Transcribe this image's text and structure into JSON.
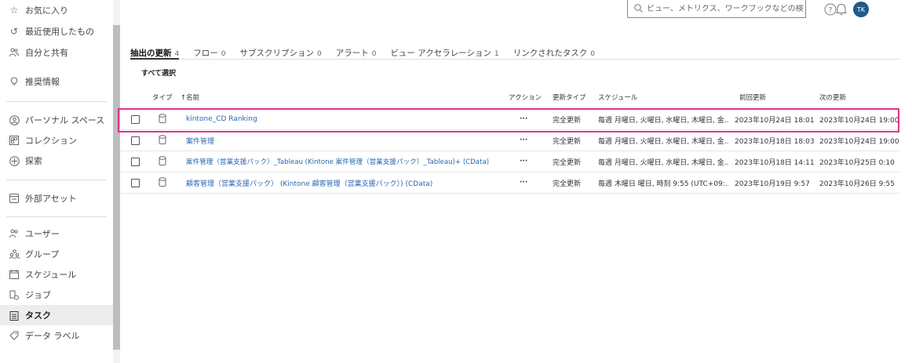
{
  "sidebar": {
    "items": [
      {
        "label": "お気に入り",
        "icon": "star-icon"
      },
      {
        "label": "最近使用したもの",
        "icon": "history-icon"
      },
      {
        "label": "自分と共有",
        "icon": "shared-users-icon"
      },
      {
        "label": "推奨情報",
        "icon": "lightbulb-icon"
      },
      {
        "label": "パーソナル スペース",
        "icon": "personal-space-icon"
      },
      {
        "label": "コレクション",
        "icon": "collection-icon"
      },
      {
        "label": "探索",
        "icon": "explore-icon"
      },
      {
        "label": "外部アセット",
        "icon": "external-assets-icon"
      },
      {
        "label": "ユーザー",
        "icon": "user-icon"
      },
      {
        "label": "グループ",
        "icon": "group-icon"
      },
      {
        "label": "スケジュール",
        "icon": "schedule-icon"
      },
      {
        "label": "ジョブ",
        "icon": "job-icon"
      },
      {
        "label": "タスク",
        "icon": "task-icon"
      },
      {
        "label": "データ ラベル",
        "icon": "data-label-icon"
      }
    ]
  },
  "header": {
    "search_placeholder": "ビュー、メトリクス、ワークブックなどの検索",
    "avatar_initials": "TK"
  },
  "tabs": [
    {
      "label": "抽出の更新",
      "count": "4"
    },
    {
      "label": "フロー",
      "count": "0"
    },
    {
      "label": "サブスクリプション",
      "count": "0"
    },
    {
      "label": "アラート",
      "count": "0"
    },
    {
      "label": "ビュー アクセラレーション",
      "count": "1"
    },
    {
      "label": "リンクされたタスク",
      "count": "0"
    }
  ],
  "select_all": "すべて選択",
  "table": {
    "headers": {
      "type": "タイプ",
      "name": "↑名前",
      "action": "アクション",
      "update_type": "更新タイプ",
      "schedule": "スケジュール",
      "last_update": "前回更新",
      "next_update": "次の更新"
    },
    "rows": [
      {
        "name": "kintone_CD Ranking",
        "action": "···",
        "update_type": "完全更新",
        "schedule": "毎週 月曜日, 火曜日, 水曜日, 木曜日, 金...",
        "last_update": "2023年10月24日 18:01",
        "next_update": "2023年10月24日 19:00"
      },
      {
        "name": "案件管理",
        "action": "···",
        "update_type": "完全更新",
        "schedule": "毎週 月曜日, 火曜日, 水曜日, 木曜日, 金...",
        "last_update": "2023年10月18日 18:03",
        "next_update": "2023年10月24日 19:00"
      },
      {
        "name": "案件管理（営業支援パック）_Tableau (Kintone 案件管理（営業支援パック）_Tableau)+ (CData)",
        "action": "···",
        "update_type": "完全更新",
        "schedule": "毎週 月曜日, 火曜日, 水曜日, 木曜日, 金...",
        "last_update": "2023年10月18日 14:11",
        "next_update": "2023年10月25日 0:10"
      },
      {
        "name": "顧客管理（営業支援パック） (Kintone 顧客管理（営業支援パック）) (CData)",
        "action": "···",
        "update_type": "完全更新",
        "schedule": "毎週 木曜日 曜日, 時刻 9:55 (UTC+09:...",
        "last_update": "2023年10月19日 9:57",
        "next_update": "2023年10月26日 9:55"
      }
    ]
  },
  "colors": {
    "highlight": "#e0338f",
    "link": "#2a68b0",
    "avatar_bg": "#1f5a8a"
  }
}
